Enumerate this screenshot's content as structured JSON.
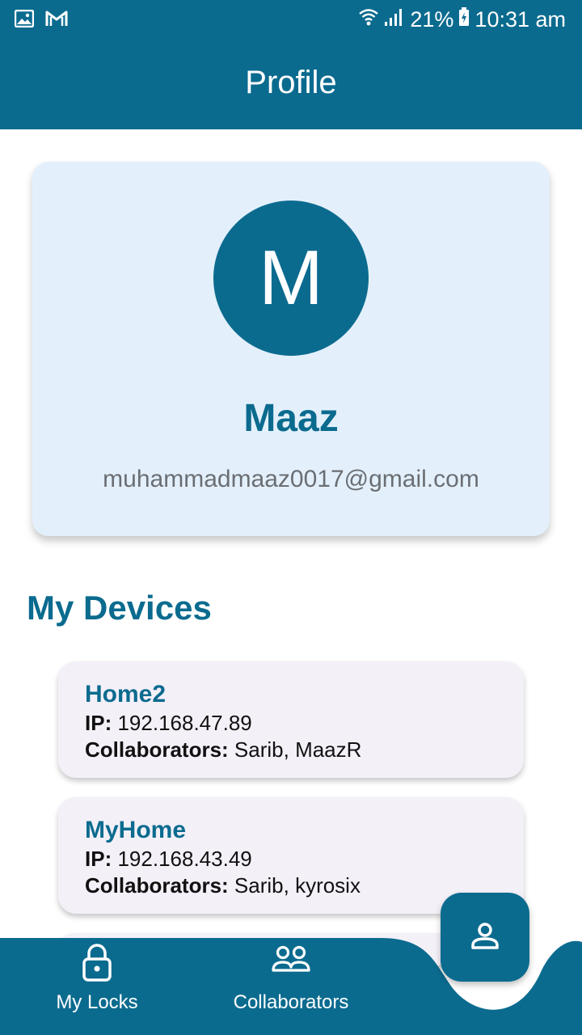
{
  "status_bar": {
    "percent": "21%",
    "time": "10:31 am",
    "icons": [
      "image-icon",
      "gmail-icon",
      "wifi-icon",
      "signal-icon",
      "battery-charging-icon"
    ]
  },
  "header": {
    "title": "Profile"
  },
  "profile": {
    "initial": "M",
    "name": "Maaz",
    "email": "muhammadmaaz0017@gmail.com"
  },
  "devices_section": {
    "title": "My Devices"
  },
  "devices": [
    {
      "name": "Home2",
      "ip_label": "IP:",
      "ip": "192.168.47.89",
      "collab_label": "Collaborators:",
      "collaborators": "Sarib, MaazR"
    },
    {
      "name": "MyHome",
      "ip_label": "IP:",
      "ip": "192.168.43.49",
      "collab_label": "Collaborators:",
      "collaborators": "Sarib, kyrosix"
    }
  ],
  "bottom_nav": {
    "items": [
      {
        "label": "My Locks",
        "icon": "lock-icon"
      },
      {
        "label": "Collaborators",
        "icon": "people-icon"
      }
    ],
    "fab_icon": "person-icon"
  },
  "colors": {
    "primary": "#0b6b8f",
    "profile_card_bg": "#e3f0fb",
    "device_card_bg": "#f4f0f8",
    "email_text": "#6b6e73"
  }
}
